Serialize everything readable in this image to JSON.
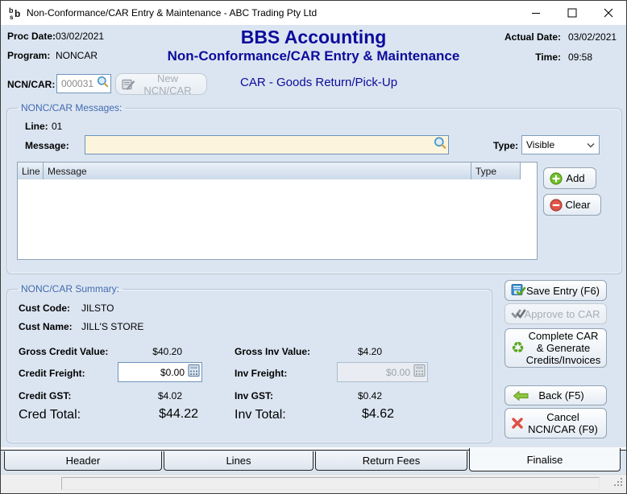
{
  "window": {
    "title": "Non-Conformance/CAR Entry & Maintenance - ABC Trading Pty Ltd"
  },
  "header": {
    "proc_date_label": "Proc Date:",
    "proc_date": "03/02/2021",
    "program_label": "Program:",
    "program": "NONCAR",
    "app_title": "BBS Accounting",
    "screen_title": "Non-Conformance/CAR Entry & Maintenance",
    "actual_date_label": "Actual Date:",
    "actual_date": "03/02/2021",
    "time_label": "Time:",
    "time": "09:58"
  },
  "ncn": {
    "label": "NCN/CAR:",
    "value": "000031",
    "new_button": "New NCN/CAR",
    "mode_title": "CAR - Goods Return/Pick-Up"
  },
  "messages": {
    "group_title": "NONC/CAR Messages:",
    "line_label": "Line:",
    "line_value": "01",
    "message_label": "Message:",
    "message_value": "",
    "type_label": "Type:",
    "type_value": "Visible",
    "table": {
      "columns": [
        "Line",
        "Message",
        "Type"
      ],
      "rows": []
    },
    "add_label": "Add",
    "clear_label": "Clear"
  },
  "summary": {
    "group_title": "NONC/CAR Summary:",
    "cust_code_label": "Cust Code:",
    "cust_code": "JILSTO",
    "cust_name_label": "Cust Name:",
    "cust_name": "JILL'S STORE",
    "gross_credit_label": "Gross Credit Value:",
    "gross_credit": "$40.20",
    "credit_freight_label": "Credit Freight:",
    "credit_freight": "$0.00",
    "credit_gst_label": "Credit GST:",
    "credit_gst": "$4.02",
    "cred_total_label": "Cred Total:",
    "cred_total": "$44.22",
    "gross_inv_label": "Gross Inv Value:",
    "gross_inv": "$4.20",
    "inv_freight_label": "Inv Freight:",
    "inv_freight": "$0.00",
    "inv_gst_label": "Inv GST:",
    "inv_gst": "$0.42",
    "inv_total_label": "Inv Total:",
    "inv_total": "$4.62"
  },
  "actions": {
    "save": "Save Entry (F6)",
    "approve": "Approve to CAR",
    "complete": "Complete CAR & Generate Credits/Invoices",
    "back": "Back (F5)",
    "cancel": "Cancel NCN/CAR (F9)"
  },
  "tabs": [
    {
      "label": "Header",
      "active": false
    },
    {
      "label": "Lines",
      "active": false
    },
    {
      "label": "Return Fees",
      "active": false
    },
    {
      "label": "Finalise",
      "active": true
    }
  ],
  "icons": {
    "app_logo": "bbs-logo",
    "lookup": "magnifier",
    "calculator": "calculator-grid",
    "add": "green-plus-circle",
    "clear": "red-minus-circle",
    "save": "blue-disk-green-check",
    "approve": "gray-double-check",
    "complete": "green-recycle",
    "back": "green-left-arrow",
    "cancel": "red-x",
    "type_dropdown": "chevron-down"
  },
  "colors": {
    "navy": "#0c0c9c",
    "legend_blue": "#3e68b0",
    "content_bg": "#dbe5f1",
    "cream_input": "#fcf4dc",
    "add_green": "#72bf2b",
    "clear_red": "#e05549"
  }
}
